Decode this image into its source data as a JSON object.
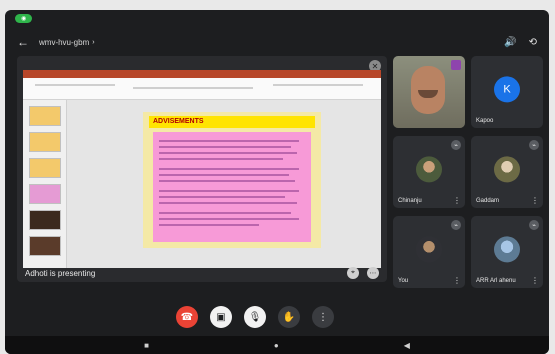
{
  "status_bar": {
    "left_text": "",
    "right_text": ""
  },
  "top_bar": {
    "meet_code": "wmv-hvu-gbm",
    "chevron": "›"
  },
  "presentation": {
    "presenter_text": "Adhoti is presenting",
    "slide_title": "ADVISEMENTS"
  },
  "participants": {
    "tiles": [
      {
        "name": "",
        "kind": "self"
      },
      {
        "name": "Kapoo",
        "avatar_letter": "K"
      },
      {
        "name": "Chinanju",
        "kind": "photo"
      },
      {
        "name": "Gaddam",
        "kind": "photo"
      },
      {
        "name": "You",
        "kind": "photo"
      },
      {
        "name": "ARR Arl ahenu",
        "kind": "photo"
      }
    ]
  },
  "controls": {
    "end_call_icon": "☎",
    "camera_icon": "▣",
    "mic_icon": "🎙",
    "hand_icon": "✋",
    "more_icon": "⋮"
  },
  "android_nav": {
    "back": "◀",
    "home": "●",
    "recents": "■"
  }
}
